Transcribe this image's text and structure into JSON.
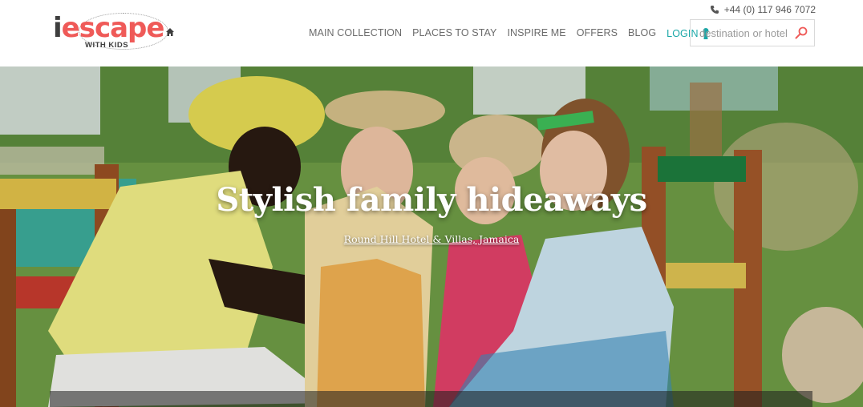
{
  "header": {
    "logo": {
      "word_i": "i",
      "word_rest": "escape",
      "tagline": "WITH KIDS"
    },
    "phone": "+44 (0) 117 946 7072",
    "nav": [
      "MAIN COLLECTION",
      "PLACES TO STAY",
      "INSPIRE ME",
      "OFFERS",
      "BLOG"
    ],
    "login": "LOGIN",
    "search": {
      "placeholder": "destination or hotel"
    }
  },
  "hero": {
    "title": "Stylish family hideaways",
    "caption": "Round Hill Hotel & Villas, Jamaica"
  },
  "colors": {
    "brand_red": "#ef5a58",
    "login_teal": "#1aa7a7",
    "nav_gray": "#6b6b6b"
  },
  "icons": [
    "phone-icon",
    "house-icon",
    "keyhole-icon",
    "search-icon"
  ]
}
